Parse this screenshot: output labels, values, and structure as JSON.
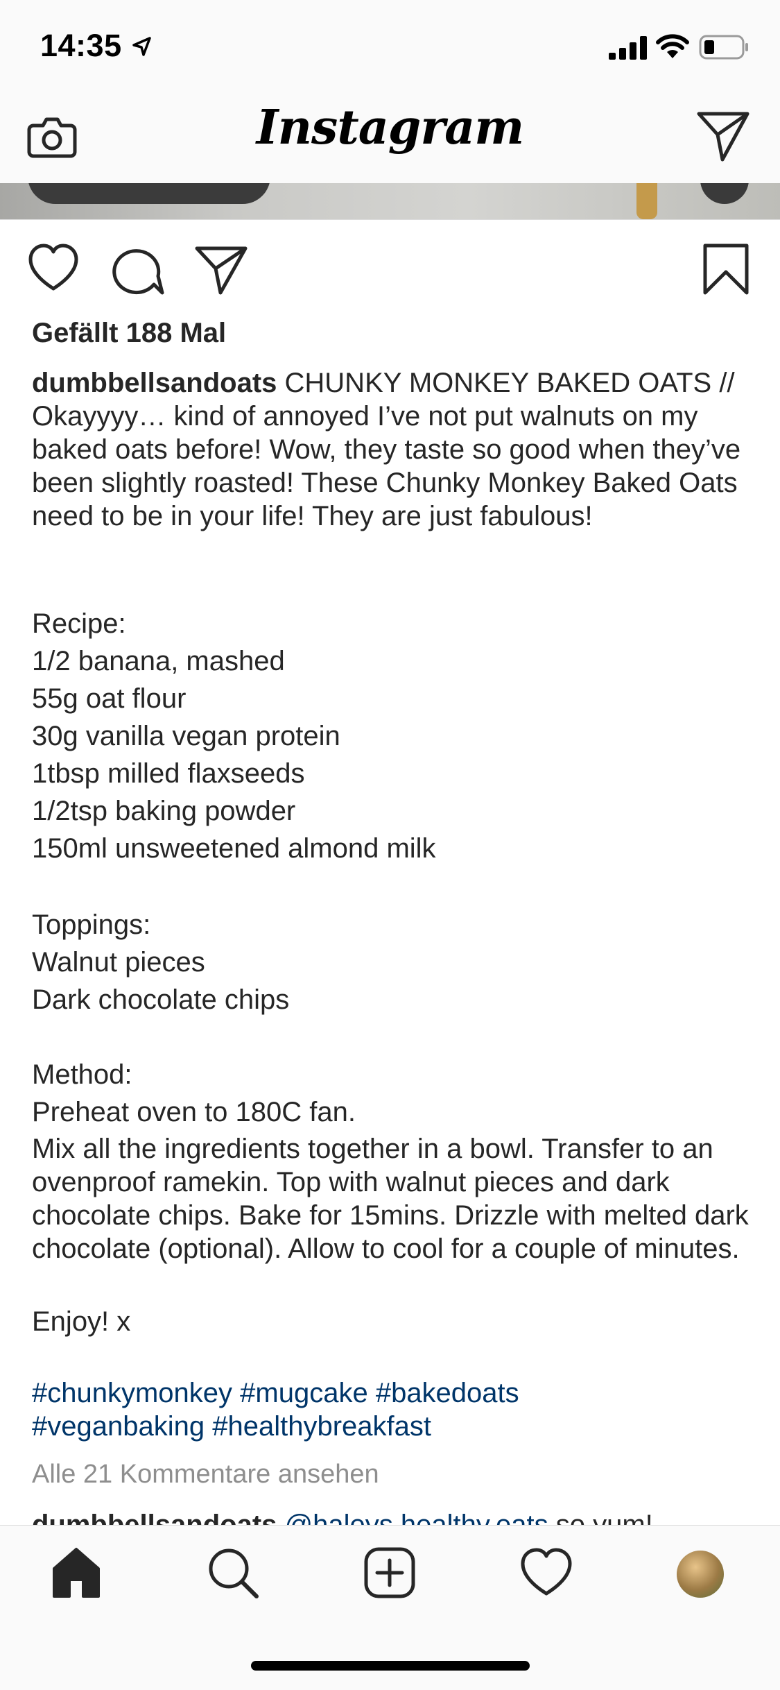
{
  "status_bar": {
    "time": "14:35"
  },
  "header": {
    "wordmark": "Instagram"
  },
  "post": {
    "likes": "Gefällt 188 Mal",
    "username": "dumbbellsandoats",
    "caption_intro": "CHUNKY MONKEY BAKED OATS // Okayyyy… kind of annoyed I’ve not put walnuts on my baked oats before! Wow, they taste so good when they’ve been slightly roasted! These Chunky Monkey Baked Oats need to be in your life! They are just fabulous!",
    "recipe_heading": "Recipe:",
    "ingredients": [
      "1/2 banana, mashed",
      "55g oat flour",
      "30g vanilla vegan protein",
      "1tbsp milled flaxseeds",
      "1/2tsp baking powder",
      "150ml unsweetened almond milk"
    ],
    "toppings_heading": "Toppings:",
    "toppings": [
      "Walnut pieces",
      "Dark chocolate chips"
    ],
    "method_heading": "Method:",
    "method_step1": "Preheat oven to 180C fan.",
    "method_step2": "Mix all the ingredients together in a bowl. Transfer to an ovenproof ramekin. Top with walnut pieces and dark chocolate chips. Bake for 15mins. Drizzle with melted dark chocolate (optional). Allow to cool for a couple of minutes.",
    "sign_off": "Enjoy! x",
    "hashtags_line1": "#chunkymonkey #mugcake #bakedoats",
    "hashtags_line2": "#veganbaking #healthybreakfast",
    "view_comments": "Alle 21 Kommentare ansehen",
    "comment": {
      "user": "dumbbellsandoats",
      "mention": "@haleys.healthy.eats",
      "text": "so yum!"
    }
  },
  "icons": {
    "camera": "camera-icon",
    "direct": "paper-plane-icon",
    "like": "heart-icon",
    "comment": "comment-bubble-icon",
    "share": "paper-plane-icon",
    "save": "bookmark-icon",
    "home": "home-icon",
    "search": "search-icon",
    "new_post": "plus-square-icon",
    "activity": "heart-icon",
    "profile": "avatar"
  },
  "colors": {
    "text": "#262626",
    "link": "#003569",
    "muted": "#8e8e8e",
    "bar_background": "#fafafa"
  }
}
